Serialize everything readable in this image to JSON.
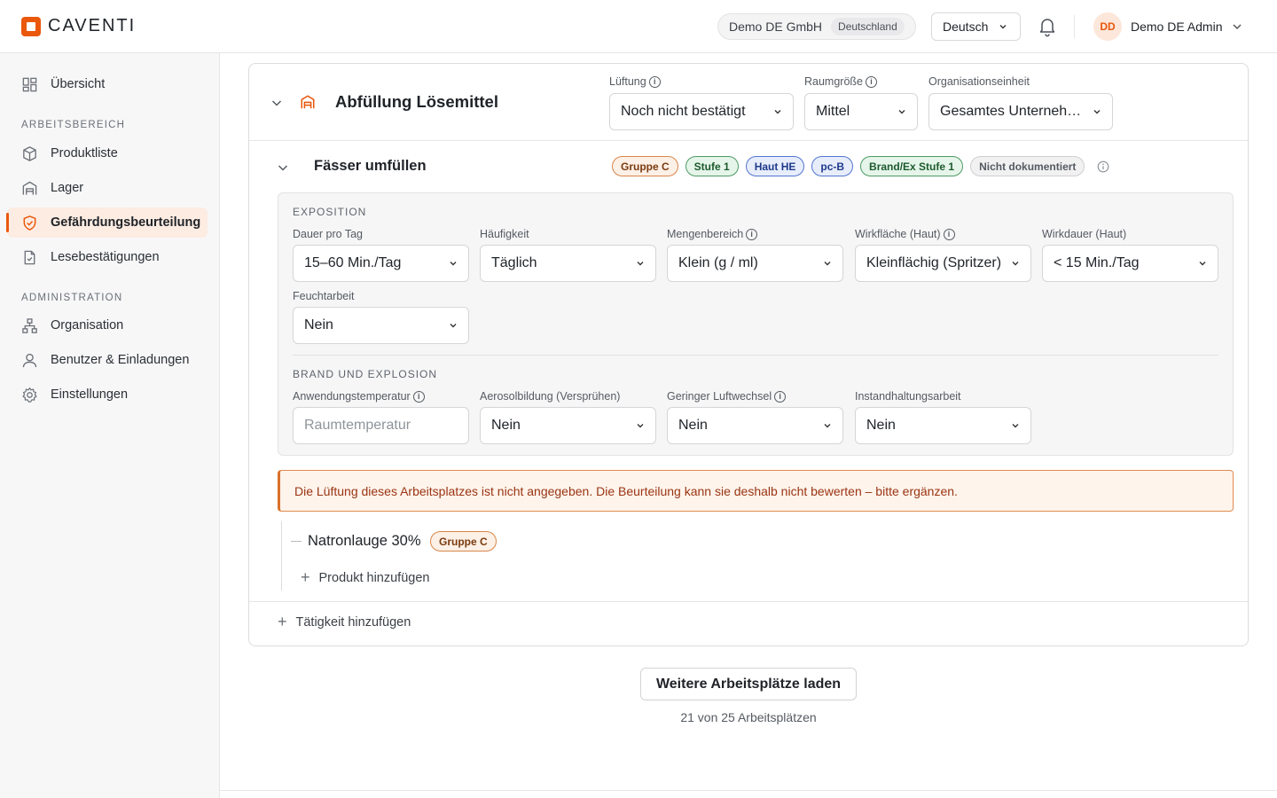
{
  "header": {
    "brand": "CAVENTI",
    "org_name": "Demo DE GmbH",
    "org_country": "Deutschland",
    "language": "Deutsch",
    "user_initials": "DD",
    "user_name": "Demo DE Admin"
  },
  "sidebar": {
    "overview": "Übersicht",
    "section_work": "ARBEITSBEREICH",
    "product_list": "Produktliste",
    "storage": "Lager",
    "risk_assessment": "Gefährdungsbeurteilung",
    "read_confirmations": "Lesebestätigungen",
    "section_admin": "ADMINISTRATION",
    "organisation": "Organisation",
    "users": "Benutzer & Einladungen",
    "settings": "Einstellungen"
  },
  "workplace": {
    "title": "Abfüllung Lösemittel",
    "ventilation_label": "Lüftung",
    "ventilation_value": "Noch nicht bestätigt",
    "room_size_label": "Raumgröße",
    "room_size_value": "Mittel",
    "org_unit_label": "Organisationseinheit",
    "org_unit_value": "Gesamtes Unterneh…"
  },
  "activity": {
    "title": "Fässer umfüllen",
    "badges": [
      "Gruppe C",
      "Stufe 1",
      "Haut HE",
      "pc-B",
      "Brand/Ex Stufe 1",
      "Nicht dokumentiert"
    ],
    "exposure_section": "EXPOSITION",
    "duration_label": "Dauer pro Tag",
    "duration_value": "15–60 Min./Tag",
    "frequency_label": "Häufigkeit",
    "frequency_value": "Täglich",
    "quantity_label": "Mengenbereich",
    "quantity_value": "Klein (g / ml)",
    "skin_area_label": "Wirkfläche (Haut)",
    "skin_area_value": "Kleinflächig (Spritzer)",
    "skin_duration_label": "Wirkdauer (Haut)",
    "skin_duration_value": "< 15 Min./Tag",
    "wet_work_label": "Feuchtarbeit",
    "wet_work_value": "Nein",
    "fire_section": "BRAND UND EXPLOSION",
    "temp_label": "Anwendungstemperatur",
    "temp_placeholder": "Raumtemperatur",
    "aerosol_label": "Aerosolbildung (Versprühen)",
    "aerosol_value": "Nein",
    "air_change_label": "Geringer Luftwechsel",
    "air_change_value": "Nein",
    "maintenance_label": "Instandhaltungsarbeit",
    "maintenance_value": "Nein",
    "warning": "Die Lüftung dieses Arbeitsplatzes ist nicht angegeben. Die Beurteilung kann sie deshalb nicht bewerten – bitte ergänzen.",
    "product_name": "Natronlauge 30%",
    "product_badge": "Gruppe C",
    "add_product": "Produkt hinzufügen"
  },
  "add_activity": "Tätigkeit hinzufügen",
  "load_more": "Weitere Arbeitsplätze laden",
  "count_text": "21 von 25 Arbeitsplätzen",
  "colors": {
    "accent": "#ea580c",
    "warning_bg": "#fef4ec"
  }
}
